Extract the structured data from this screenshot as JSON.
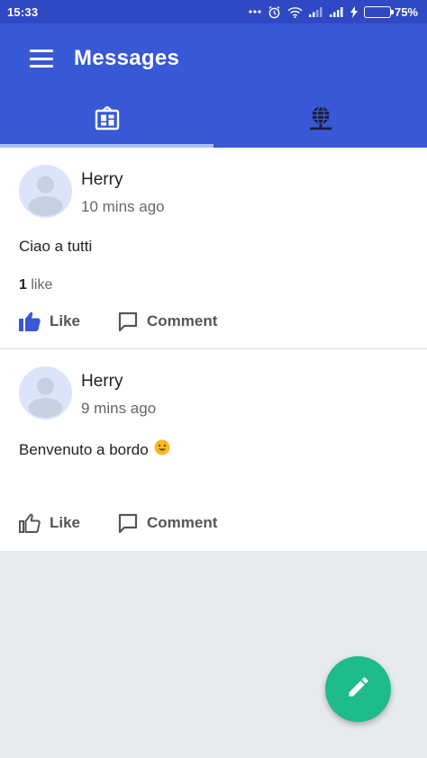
{
  "status_bar": {
    "time": "15:33",
    "battery_percent": "75%",
    "battery_level": 0.75,
    "icons": [
      "more-dots-icon",
      "alarm-icon",
      "wifi-icon",
      "signal-icon",
      "signal-icon",
      "charging-icon",
      "battery-icon"
    ]
  },
  "app_bar": {
    "title": "Messages",
    "menu_icon": "menu-icon"
  },
  "tabs": [
    {
      "icon": "dashboard-icon",
      "active": true
    },
    {
      "icon": "globe-network-icon",
      "active": false
    }
  ],
  "posts": [
    {
      "author": "Herry",
      "time": "10 mins ago",
      "text": "Ciao a tutti",
      "emoji": "",
      "likes_count": "1",
      "likes_label": "like",
      "liked": true,
      "like_label": "Like",
      "comment_label": "Comment"
    },
    {
      "author": "Herry",
      "time": "9 mins ago",
      "text": "Benvenuto a bordo",
      "emoji": "smiley-icon",
      "likes_count": "",
      "likes_label": "",
      "liked": false,
      "like_label": "Like",
      "comment_label": "Comment"
    }
  ],
  "fab": {
    "icon": "pencil-icon"
  },
  "colors": {
    "status_bar": "#2f49c4",
    "primary": "#3858d6",
    "tab_indicator": "#a9c0f6",
    "fab": "#1ebc8a",
    "like_active": "#3858d6",
    "background": "#e8ebee"
  }
}
